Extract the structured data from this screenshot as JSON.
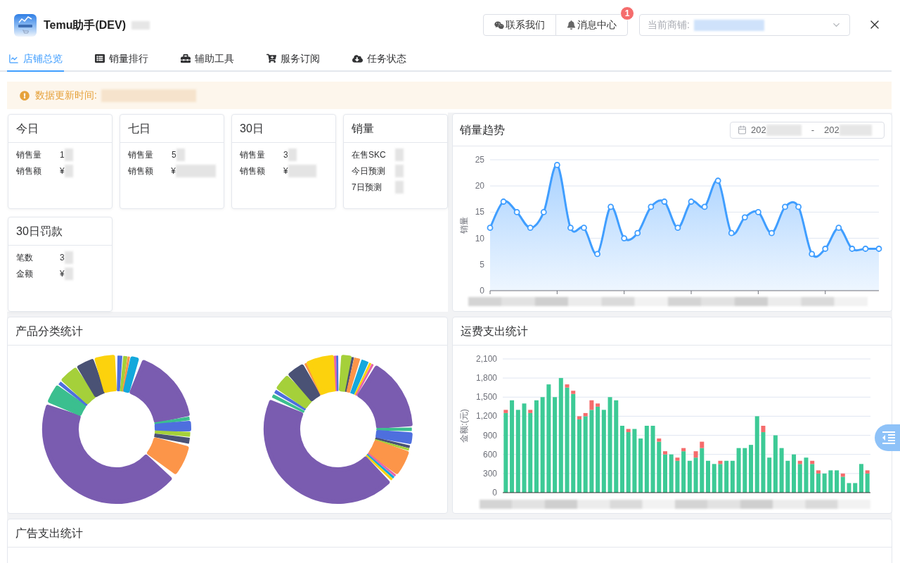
{
  "header": {
    "app_title": "Temu助手(DEV)",
    "buttons": [
      {
        "kind": "wechat",
        "label": "联系我们"
      },
      {
        "kind": "bell",
        "label": "消息中心",
        "badge": "1"
      }
    ],
    "store_select": {
      "label": "当前商铺:"
    }
  },
  "tabs": [
    {
      "label": "店铺总览",
      "selected": true
    },
    {
      "label": "销量排行",
      "selected": false
    },
    {
      "label": "辅助工具",
      "selected": false
    },
    {
      "label": "服务订阅",
      "selected": false
    },
    {
      "label": "任务状态",
      "selected": false
    }
  ],
  "alert": {
    "label": "数据更新时间:"
  },
  "stat_cards": [
    {
      "title": "今日",
      "rows": [
        {
          "label": "销售量",
          "value": "1"
        },
        {
          "label": "销售额",
          "value": "¥"
        }
      ]
    },
    {
      "title": "七日",
      "rows": [
        {
          "label": "销售量",
          "value": "5"
        },
        {
          "label": "销售额",
          "value": "¥"
        }
      ]
    },
    {
      "title": "30日",
      "rows": [
        {
          "label": "销售量",
          "value": "3"
        },
        {
          "label": "销售额",
          "value": "¥"
        }
      ]
    },
    {
      "title": "销量",
      "rows": [
        {
          "label": "在售SKC"
        },
        {
          "label": "今日预测"
        },
        {
          "label": "7日预测"
        }
      ]
    },
    {
      "title": "30日罚款",
      "rows": [
        {
          "label": "笔数",
          "value": "3"
        },
        {
          "label": "金额",
          "value": "¥"
        }
      ]
    }
  ],
  "sales_trend": {
    "title": "销量趋势",
    "date_range": {
      "start": "202",
      "separator": "-",
      "end": "202"
    },
    "chart_data": {
      "type": "area",
      "ylabel": "销量",
      "grid": true,
      "ylim": [
        0,
        25
      ],
      "yticks": [
        0,
        5,
        10,
        15,
        20,
        25
      ],
      "values": [
        12,
        17,
        15,
        12,
        15,
        24,
        12,
        12,
        7,
        16,
        10,
        11,
        16,
        17,
        12,
        17,
        16,
        21,
        11,
        14,
        15,
        11,
        16,
        16,
        7,
        8,
        12,
        8,
        8,
        8
      ]
    }
  },
  "category_stats": {
    "title": "产品分类统计"
  },
  "shipping_cost": {
    "title": "运费支出统计",
    "chart_data": {
      "type": "bar",
      "stacked": true,
      "grid": true,
      "ylabel": "金额:(元)",
      "ylim": [
        0,
        2100
      ],
      "yticks": [
        {
          "value": 0,
          "label": "0"
        },
        {
          "value": 300,
          "label": "300"
        },
        {
          "value": 600,
          "label": "600"
        },
        {
          "value": 900,
          "label": "900"
        },
        {
          "value": 1200,
          "label": "1,200"
        },
        {
          "value": 1500,
          "label": "1,500"
        },
        {
          "value": 1800,
          "label": "1,800"
        },
        {
          "value": 2100,
          "label": "2,100"
        }
      ],
      "series": [
        {
          "color": "#3dca96",
          "values": [
            1250,
            1450,
            1300,
            1400,
            1250,
            1450,
            1500,
            1700,
            1500,
            1800,
            1650,
            1550,
            1150,
            1200,
            1300,
            1350,
            1300,
            1500,
            1450,
            1050,
            950,
            1000,
            850,
            1050,
            1050,
            800,
            600,
            600,
            500,
            650,
            500,
            550,
            700,
            500,
            450,
            450,
            500,
            500,
            700,
            700,
            750,
            1200,
            950,
            550,
            900,
            700,
            500,
            600,
            450,
            550,
            450,
            300,
            300,
            350,
            350,
            250,
            150,
            150,
            450,
            300
          ]
        },
        {
          "color": "#f56c6c",
          "values": [
            50,
            0,
            0,
            0,
            50,
            0,
            0,
            0,
            0,
            0,
            50,
            50,
            50,
            50,
            150,
            50,
            0,
            0,
            0,
            0,
            50,
            0,
            0,
            0,
            0,
            50,
            50,
            0,
            50,
            50,
            0,
            100,
            100,
            0,
            0,
            50,
            0,
            0,
            0,
            0,
            0,
            0,
            100,
            0,
            0,
            0,
            0,
            0,
            50,
            0,
            50,
            50,
            0,
            0,
            0,
            50,
            0,
            0,
            0,
            50
          ]
        }
      ]
    }
  },
  "ad_spend": {
    "title": "广告支出统计"
  }
}
